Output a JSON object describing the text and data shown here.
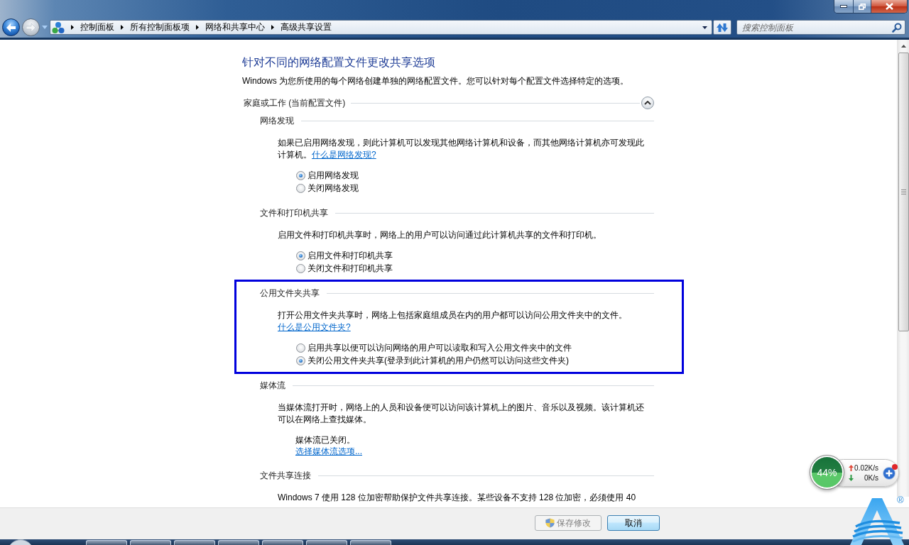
{
  "address_bar": {
    "breadcrumbs": [
      "控制面板",
      "所有控制面板项",
      "网络和共享中心",
      "高级共享设置"
    ]
  },
  "search": {
    "placeholder": "搜索控制面板"
  },
  "page": {
    "title": "针对不同的网络配置文件更改共享选项",
    "description": "Windows 为您所使用的每个网络创建单独的网络配置文件。您可以针对每个配置文件选择特定的选项。"
  },
  "profile": {
    "label": "家庭或工作 (当前配置文件)",
    "expanded": true
  },
  "sections": [
    {
      "kind": "options",
      "heading": "网络发现",
      "highlighted": false,
      "text": "如果已启用网络发现，则此计算机可以发现其他网络计算机和设备，而其他网络计算机亦可发现此计算机。",
      "link": "什么是网络发现?",
      "options": [
        {
          "label": "启用网络发现",
          "selected": true
        },
        {
          "label": "关闭网络发现",
          "selected": false
        }
      ]
    },
    {
      "kind": "options",
      "heading": "文件和打印机共享",
      "highlighted": false,
      "text": "启用文件和打印机共享时，网络上的用户可以访问通过此计算机共享的文件和打印机。",
      "options": [
        {
          "label": "启用文件和打印机共享",
          "selected": true
        },
        {
          "label": "关闭文件和打印机共享",
          "selected": false
        }
      ]
    },
    {
      "kind": "options",
      "heading": "公用文件夹共享",
      "highlighted": true,
      "text": "打开公用文件夹共享时，网络上包括家庭组成员在内的用户都可以访问公用文件夹中的文件。",
      "link": "什么是公用文件夹?",
      "options": [
        {
          "label": "启用共享以便可以访问网络的用户可以读取和写入公用文件夹中的文件",
          "selected": false
        },
        {
          "label": "关闭公用文件夹共享(登录到此计算机的用户仍然可以访问这些文件夹)",
          "selected": true
        }
      ]
    },
    {
      "kind": "status",
      "heading": "媒体流",
      "highlighted": false,
      "text": "当媒体流打开时，网络上的人员和设备便可以访问该计算机上的图片、音乐以及视频。该计算机还可以在网络上查找媒体。",
      "status": "媒体流已关闭。",
      "link": "选择媒体流选项..."
    },
    {
      "kind": "text",
      "heading": "文件共享连接",
      "highlighted": false,
      "text": "Windows 7 使用 128 位加密帮助保护文件共享连接。某些设备不支持 128 位加密，必须使用 40"
    }
  ],
  "buttons": [
    {
      "kind": "save",
      "label": "保存修改",
      "disabled": true
    },
    {
      "kind": "cancel",
      "label": "取消",
      "disabled": false
    }
  ],
  "network_monitor": {
    "memory": "44%",
    "upload": "0.02K/s",
    "download": "0K/s"
  },
  "logo": {
    "mark": "®"
  }
}
